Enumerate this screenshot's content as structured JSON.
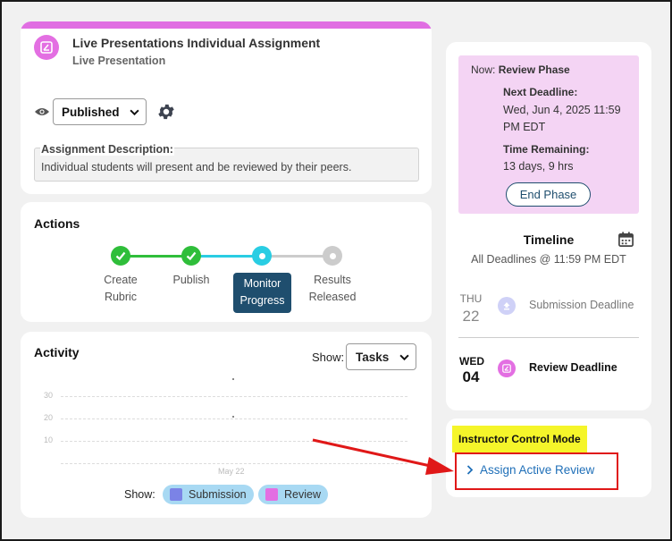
{
  "assignment": {
    "title": "Live Presentations Individual Assignment",
    "type": "Live Presentation",
    "status": "Published",
    "description_label": "Assignment Description:",
    "description": "Individual students will present and be reviewed by their peers."
  },
  "actions": {
    "title": "Actions",
    "steps": [
      {
        "line1": "Create",
        "line2": "Rubric",
        "state": "done"
      },
      {
        "line1": "Publish",
        "line2": "",
        "state": "done"
      },
      {
        "line1": "Monitor",
        "line2": "Progress",
        "state": "current"
      },
      {
        "line1": "Results",
        "line2": "Released",
        "state": "pending"
      }
    ]
  },
  "activity": {
    "title": "Activity",
    "show_label": "Show:",
    "selected": "Tasks",
    "y_ticks": [
      "30",
      "20",
      "10"
    ],
    "x_tick": "May 22",
    "legend_show": "Show:",
    "legend": [
      {
        "label": "Submission",
        "color": "#7b83e6"
      },
      {
        "label": "Review",
        "color": "#e36fe2"
      }
    ]
  },
  "phase": {
    "now_prefix": "Now:",
    "now_value": "Review Phase",
    "next_deadline_label": "Next Deadline:",
    "next_deadline_value": "Wed, Jun 4, 2025 11:59 PM EDT",
    "time_remaining_label": "Time Remaining:",
    "time_remaining_value": "13 days, 9 hrs",
    "end_button": "End Phase"
  },
  "timeline": {
    "title": "Timeline",
    "subtitle": "All Deadlines @ 11:59 PM EDT",
    "items": [
      {
        "day": "THU",
        "date": "22",
        "name": "Submission Deadline",
        "active": false
      },
      {
        "day": "WED",
        "date": "04",
        "name": "Review Deadline",
        "active": true
      }
    ]
  },
  "instructor": {
    "mode_label": "Instructor Control Mode",
    "link": "Assign Active Review"
  },
  "colors": {
    "accent_pink": "#e06ee2",
    "done_green": "#2fbe3a",
    "current_cyan": "#29cde3",
    "pending_gray": "#cccccc",
    "navy": "#1f4e6e",
    "link_blue": "#1f6fb8",
    "annotation_red": "#e01818"
  }
}
